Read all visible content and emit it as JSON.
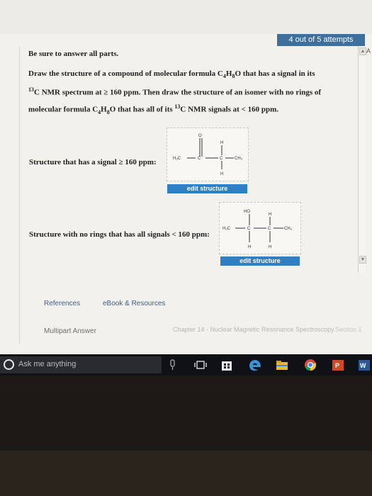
{
  "header": {
    "attempts": "4 out of 5 attempts"
  },
  "question": {
    "instruction": "Be sure to answer all parts.",
    "line1_a": "Draw the structure of a compound of molecular formula C",
    "line1_s1": "4",
    "line1_b": "H",
    "line1_s2": "8",
    "line1_c": "O that has a signal in its",
    "line2_sup": "13",
    "line2_a": "C NMR spectrum at ≥ 160 ppm. Then draw the structure of an isomer with no rings of",
    "line3_a": "molecular formula C",
    "line3_s1": "4",
    "line3_b": "H",
    "line3_s2": "8",
    "line3_c": "O that has all of its ",
    "line3_sup": "13",
    "line3_d": "C NMR signals at < 160 ppm."
  },
  "structure1": {
    "label": "Structure that has a signal ≥ 160 ppm:",
    "edit_label": "edit structure",
    "atoms": {
      "o": "O",
      "h_top": "H",
      "h3c": "H₃C",
      "c1": "C",
      "c2": "C",
      "ch3": "CH₃",
      "h_bottom": "H"
    }
  },
  "structure2": {
    "label": "Structure with no rings that has all signals < 160 ppm:",
    "edit_label": "edit structure",
    "atoms": {
      "ho": "HO",
      "h_top": "H",
      "h3c": "H₃C",
      "c1": "C",
      "c2": "C",
      "ch3": "CH₃",
      "h_b1": "H",
      "h_b2": "H"
    }
  },
  "footer": {
    "references": "References",
    "ebook": "eBook & Resources",
    "multipart": "Multipart Answer",
    "chapter": "Chapter 14 - Nuclear Magnetic Resonance Spectroscopy",
    "section": "Section 1"
  },
  "taskbar": {
    "search_placeholder": "Ask me anything"
  },
  "scroll": {
    "up": "▲",
    "down": "▼"
  },
  "side_char": "A",
  "colors": {
    "accent": "#2f7fc5",
    "attempts_bg": "#3f6f9c"
  }
}
